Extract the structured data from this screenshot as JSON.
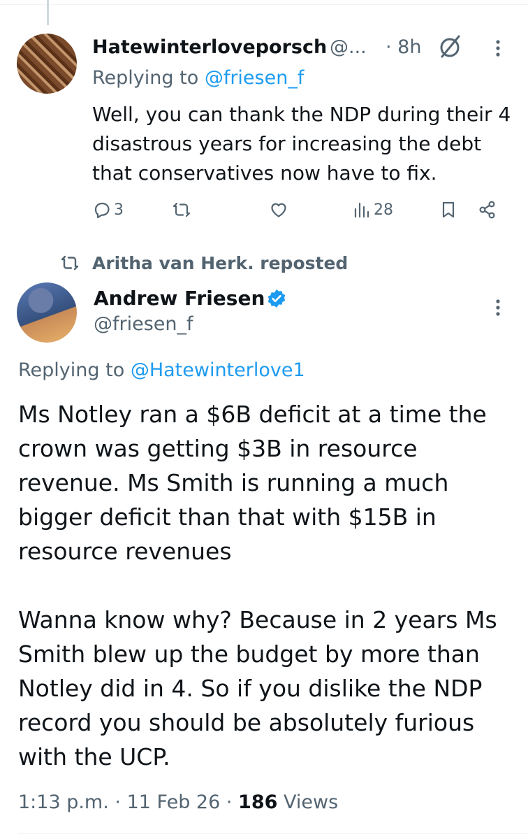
{
  "reply": {
    "display_name": "Hatewinterloveporsch",
    "handle": "@...",
    "time": "· 8h",
    "replying_prefix": "Replying to ",
    "replying_handle": "@friesen_f",
    "text": "Well, you can thank the NDP during their 4 disastrous years for increasing the debt that conservatives now have to fix.",
    "actions": {
      "replies": "3",
      "reposts": "",
      "likes": "",
      "views": "28"
    }
  },
  "repost_banner": {
    "text": "Aritha van Herk. reposted"
  },
  "main_tweet": {
    "display_name": "Andrew Friesen",
    "handle": "@friesen_f",
    "replying_prefix": "Replying to ",
    "replying_handle": "@Hatewinterlove1",
    "paragraphs": [
      "Ms Notley ran a $6B deficit at a time the crown was getting $3B in resource revenue. Ms Smith is running a much bigger deficit than that with $15B in resource revenues",
      "Wanna know why? Because in 2 years Ms Smith blew up the budget by more than Notley did in 4. So if you dislike the NDP record you should be absolutely furious with the UCP."
    ],
    "time": "1:13 p.m.",
    "date": "11 Feb 26",
    "views_count": "186",
    "views_label": "Views"
  },
  "icons": [
    "grok-icon",
    "more-icon",
    "reply-icon",
    "repost-icon",
    "like-icon",
    "views-icon",
    "bookmark-icon",
    "share-icon",
    "verified-badge-icon"
  ],
  "colors": {
    "text": "#0f1419",
    "secondary": "#536471",
    "link": "#1d9bf0",
    "verified": "#1d9bf0"
  }
}
